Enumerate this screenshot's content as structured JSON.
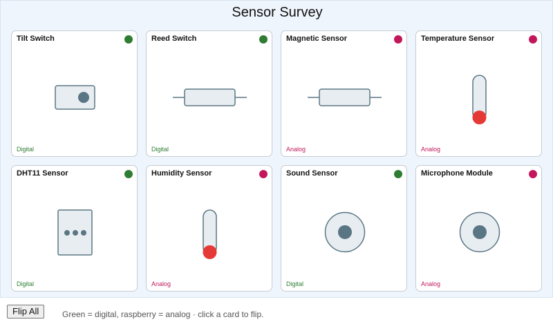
{
  "title": "Sensor Survey",
  "colors": {
    "digital": "#2e7d32",
    "analog": "#c2185b",
    "icon_stroke": "#5a7684",
    "icon_fill": "#e8edf1",
    "thermo_bulb": "#e53935"
  },
  "cards": [
    {
      "name": "Tilt Switch",
      "kind": "Digital",
      "icon": "tilt-switch-icon"
    },
    {
      "name": "Reed Switch",
      "kind": "Digital",
      "icon": "reed-switch-icon"
    },
    {
      "name": "Magnetic Sensor",
      "kind": "Analog",
      "icon": "resistor-icon"
    },
    {
      "name": "Temperature Sensor",
      "kind": "Analog",
      "icon": "thermometer-icon"
    },
    {
      "name": "DHT11 Sensor",
      "kind": "Digital",
      "icon": "dht11-module-icon"
    },
    {
      "name": "Humidity Sensor",
      "kind": "Analog",
      "icon": "thermometer-icon"
    },
    {
      "name": "Sound Sensor",
      "kind": "Digital",
      "icon": "microphone-disc-icon"
    },
    {
      "name": "Microphone Module",
      "kind": "Analog",
      "icon": "microphone-disc-icon"
    }
  ],
  "controls": {
    "flip_all_label": "Flip All",
    "hint": "Green = digital, raspberry = analog · click a card to flip."
  }
}
